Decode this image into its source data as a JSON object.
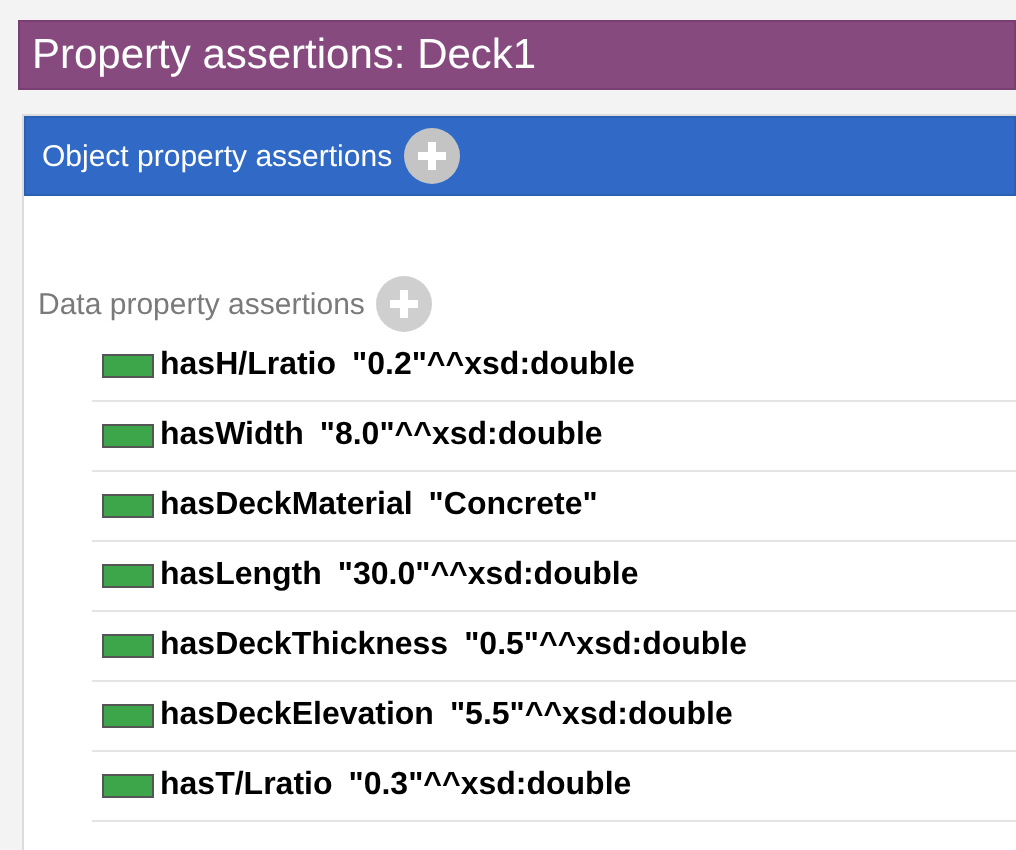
{
  "title": "Property assertions: Deck1",
  "object_section": {
    "label": "Object property assertions"
  },
  "data_section": {
    "label": "Data property assertions",
    "rows": [
      {
        "property": "hasH/Lratio",
        "value": "\"0.2\"^^xsd:double"
      },
      {
        "property": "hasWidth",
        "value": "\"8.0\"^^xsd:double"
      },
      {
        "property": "hasDeckMaterial",
        "value": "\"Concrete\""
      },
      {
        "property": "hasLength",
        "value": "\"30.0\"^^xsd:double"
      },
      {
        "property": "hasDeckThickness",
        "value": "\"0.5\"^^xsd:double"
      },
      {
        "property": "hasDeckElevation",
        "value": "\"5.5\"^^xsd:double"
      },
      {
        "property": "hasT/Lratio",
        "value": "\"0.3\"^^xsd:double"
      }
    ]
  }
}
